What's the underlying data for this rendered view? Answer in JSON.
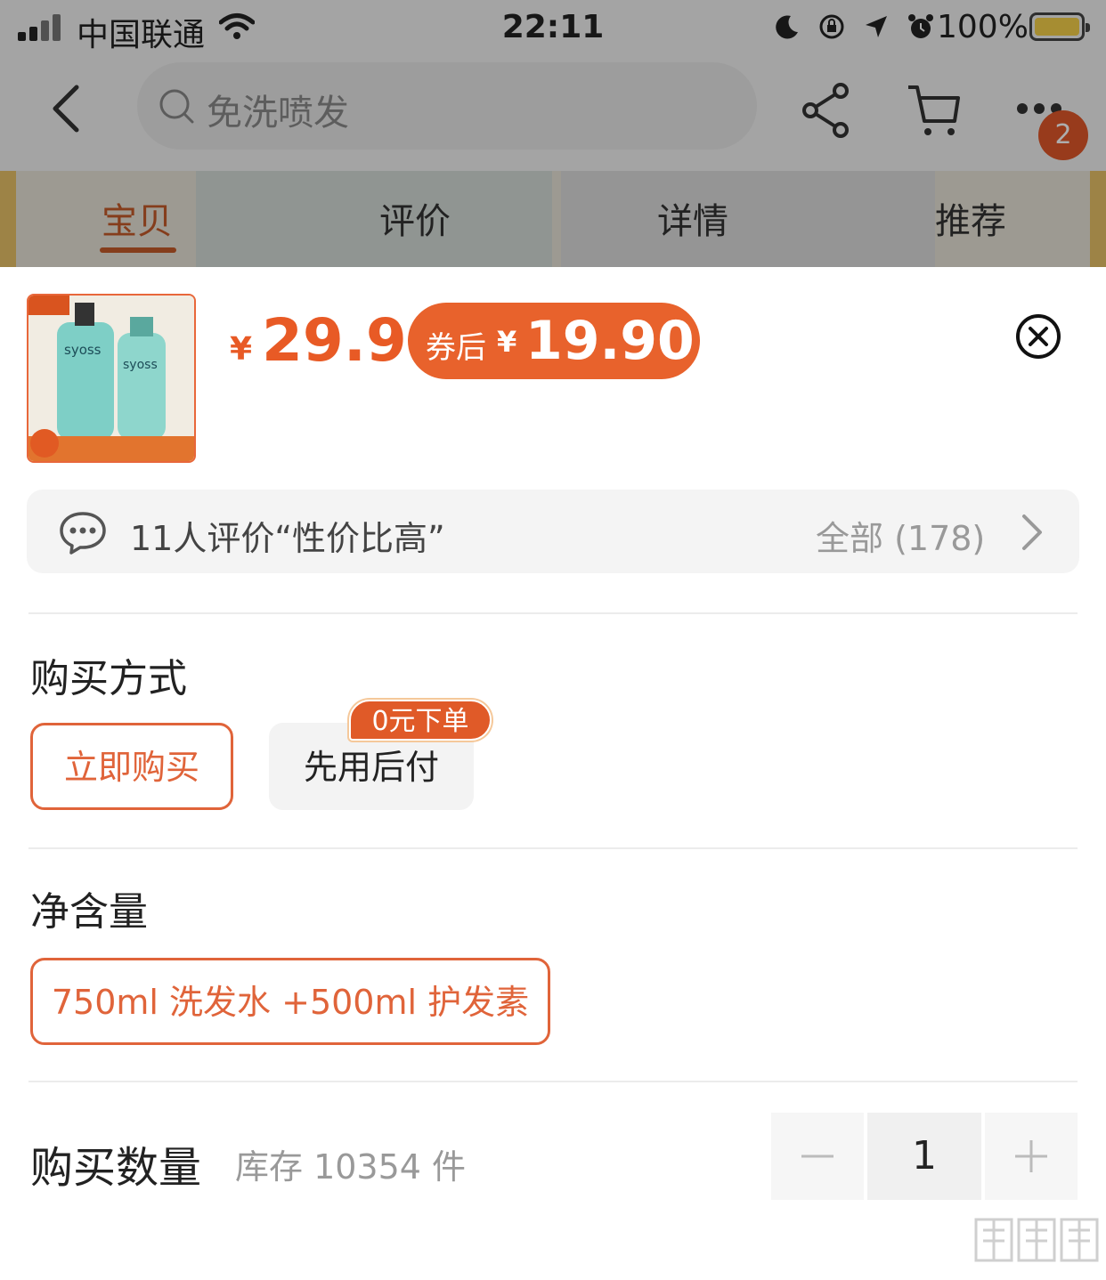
{
  "status_bar": {
    "carrier": "中国联通",
    "time": "22:11",
    "battery_percent": "100%"
  },
  "nav": {
    "search_placeholder": "免洗喷发",
    "cart_badge_count": "2"
  },
  "tabs": [
    {
      "label": "宝贝",
      "active": true
    },
    {
      "label": "评价",
      "active": false
    },
    {
      "label": "详情",
      "active": false
    },
    {
      "label": "推荐",
      "active": false
    }
  ],
  "product": {
    "thumb_brand": "syoss",
    "price_symbol": "¥",
    "price": "29.9",
    "coupon_label": "券后",
    "coupon_symbol": "¥",
    "coupon_price": "19.90"
  },
  "reviews": {
    "summary": "11人评价“性价比高”",
    "all_label": "全部 (178)"
  },
  "purchase_method": {
    "title": "购买方式",
    "options": [
      {
        "label": "立即购买",
        "selected": true
      },
      {
        "label": "先用后付",
        "selected": false,
        "tag": "0元下单"
      }
    ]
  },
  "net_content": {
    "title": "净含量",
    "options": [
      {
        "label": "750ml 洗发水 +500ml 护发素",
        "selected": true
      }
    ]
  },
  "quantity": {
    "title": "购买数量",
    "stock": "库存 10354 件",
    "value": "1"
  },
  "colors": {
    "accent": "#e85a25",
    "coupon_bg": "#e8622c"
  }
}
